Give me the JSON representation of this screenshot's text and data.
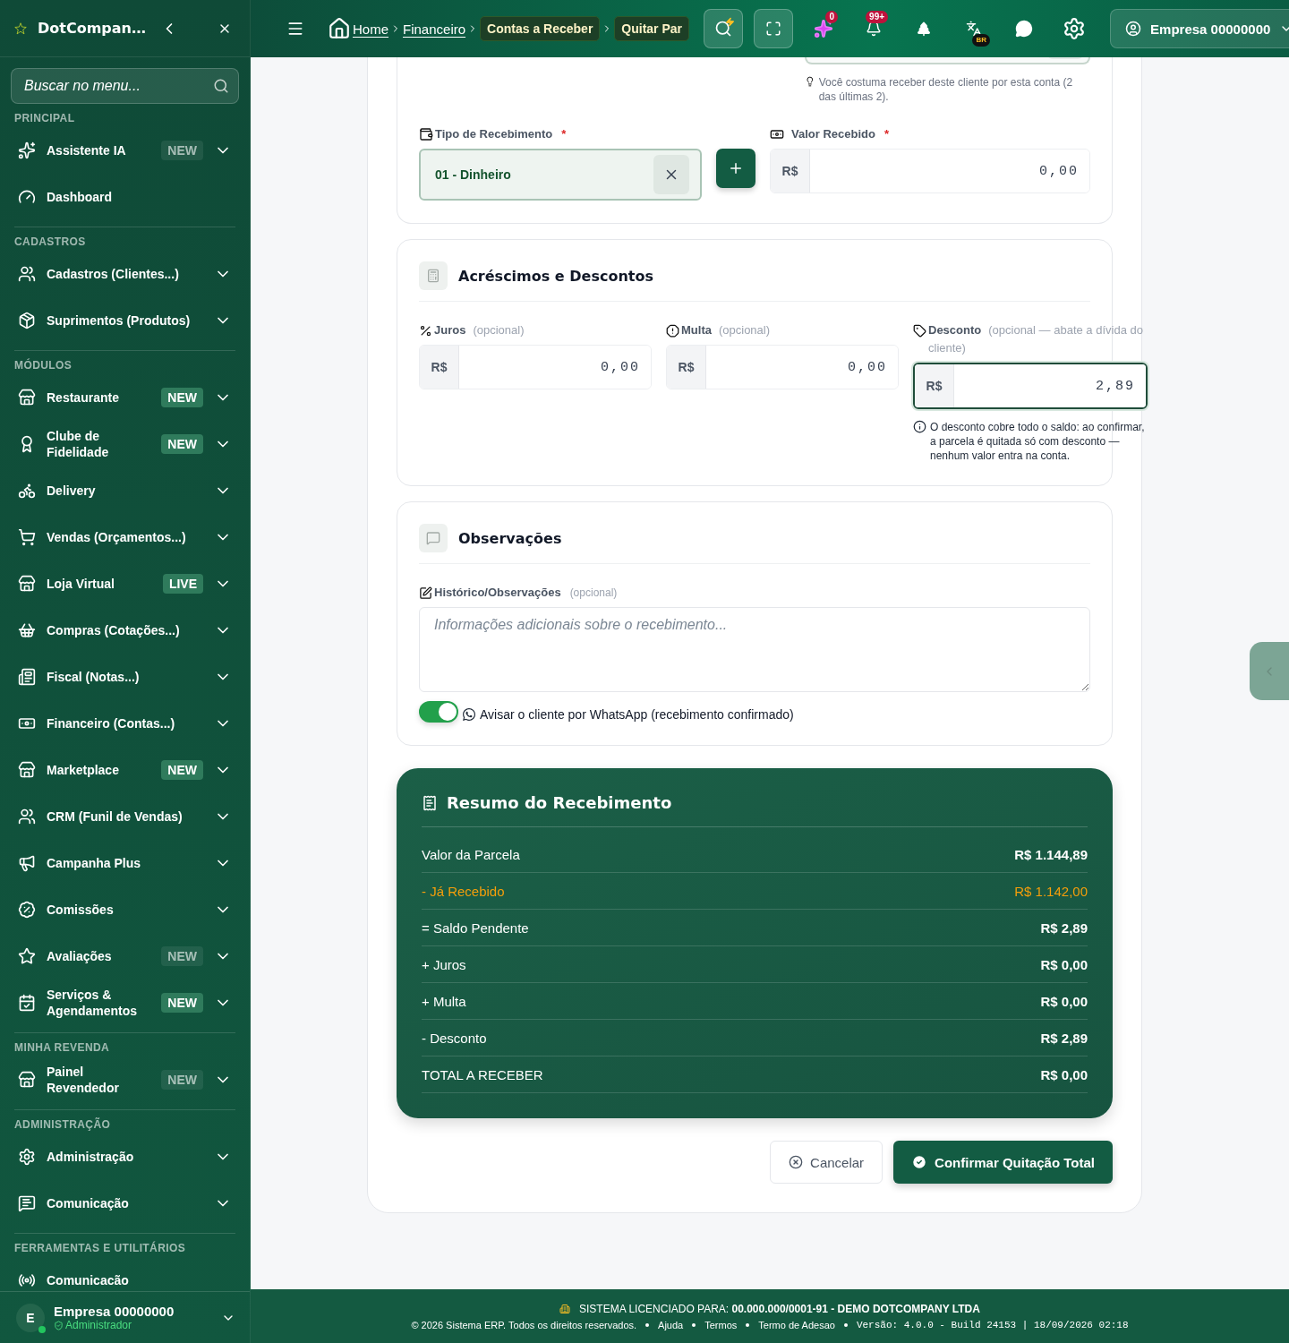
{
  "sidebar": {
    "brand": "DotCompan…",
    "search": {
      "placeholder": "Buscar no menu..."
    },
    "sections": [
      {
        "title": "PRINCIPAL",
        "items": [
          {
            "label": "Assistente IA",
            "badge": {
              "text": "NEW",
              "highlighted": false
            },
            "expandable": true
          },
          {
            "label": "Dashboard",
            "expandable": false
          }
        ]
      },
      {
        "title": "CADASTROS",
        "items": [
          {
            "label": "Cadastros (Clientes...)",
            "expandable": true
          },
          {
            "label": "Suprimentos (Produtos)",
            "expandable": true
          }
        ]
      },
      {
        "title": "MÓDULOS",
        "items": [
          {
            "label": "Restaurante",
            "badge": {
              "text": "NEW",
              "highlighted": true
            },
            "expandable": true
          },
          {
            "label": "Clube de Fidelidade",
            "badge": {
              "text": "NEW",
              "highlighted": true
            },
            "expandable": true
          },
          {
            "label": "Delivery",
            "expandable": true
          },
          {
            "label": "Vendas (Orçamentos...)",
            "expandable": true
          },
          {
            "label": "Loja Virtual",
            "badge": {
              "text": "LIVE",
              "highlighted": true
            },
            "expandable": true
          },
          {
            "label": "Compras (Cotações...)",
            "expandable": true
          },
          {
            "label": "Fiscal (Notas...)",
            "expandable": true
          },
          {
            "label": "Financeiro (Contas...)",
            "expandable": true
          },
          {
            "label": "Marketplace",
            "badge": {
              "text": "NEW",
              "highlighted": true
            },
            "expandable": true
          },
          {
            "label": "CRM (Funil de Vendas)",
            "expandable": true
          },
          {
            "label": "Campanha Plus",
            "expandable": true
          },
          {
            "label": "Comissões",
            "expandable": true
          },
          {
            "label": "Avaliações",
            "badge": {
              "text": "NEW",
              "highlighted": false
            },
            "expandable": true
          },
          {
            "label": "Serviços & Agendamentos",
            "badge": {
              "text": "NEW",
              "highlighted": true
            },
            "expandable": true
          }
        ]
      },
      {
        "title": "MINHA REVENDA",
        "items": [
          {
            "label": "Painel Revendedor",
            "badge": {
              "text": "NEW",
              "highlighted": false
            },
            "expandable": true
          }
        ]
      },
      {
        "title": "ADMINISTRAÇÃO",
        "items": [
          {
            "label": "Administração",
            "expandable": true
          },
          {
            "label": "Comunicação",
            "expandable": true
          }
        ]
      },
      {
        "title": "FERRAMENTAS E UTILITÁRIOS",
        "items": [
          {
            "label": "Comunicacão",
            "expandable": false
          }
        ]
      }
    ],
    "profile": {
      "initial": "E",
      "name": "Empresa 00000000",
      "role": "Administrador"
    }
  },
  "header": {
    "breadcrumb": [
      {
        "label": "Home",
        "kind": "link"
      },
      {
        "label": "Financeiro",
        "kind": "link"
      },
      {
        "label": "Contas a Receber",
        "kind": "chip"
      },
      {
        "label": "Quitar Par",
        "kind": "chip"
      }
    ],
    "ai_badge": "0",
    "bell_badge": "99+",
    "language_badge": "BR",
    "account": "Empresa 00000000"
  },
  "payment": {
    "hint": "Você costuma receber deste cliente por esta conta (2 das últimas 2).",
    "type_field": {
      "label": "Tipo de Recebimento",
      "required_mark": "*",
      "value": "01 - Dinheiro"
    },
    "amount_field": {
      "label": "Valor Recebido",
      "required_mark": "*",
      "prefix": "R$",
      "value": "0,00"
    }
  },
  "adjustments": {
    "title": "Acréscimos e Descontos",
    "fields": [
      {
        "label": "Juros",
        "hint": "(opcional)",
        "prefix": "R$",
        "value": "0,00",
        "focused": false
      },
      {
        "label": "Multa",
        "hint": "(opcional)",
        "prefix": "R$",
        "value": "0,00",
        "focused": false
      },
      {
        "label": "Desconto",
        "hint": "(opcional — abate a dívida do cliente)",
        "prefix": "R$",
        "value": "2,89",
        "focused": true
      }
    ],
    "note": "O desconto cobre todo o saldo: ao confirmar, a parcela é quitada só com desconto — nenhum valor entra na conta."
  },
  "observations": {
    "title": "Observações",
    "label": "Histórico/Observações",
    "hint": "(opcional)",
    "placeholder": "Informações adicionais sobre o recebimento...",
    "notify": {
      "on": true,
      "label": "Avisar o cliente por WhatsApp (recebimento confirmado)"
    }
  },
  "summary": {
    "title": "Resumo do Recebimento",
    "rows": [
      {
        "label": "Valor da Parcela",
        "value": "R$ 1.144,89",
        "kind": "normal"
      },
      {
        "label": "- Já Recebido",
        "value": "R$ 1.142,00",
        "kind": "received"
      },
      {
        "label": "= Saldo Pendente",
        "value": "R$ 2,89",
        "kind": "normal"
      },
      {
        "label": "+ Juros",
        "value": "R$ 0,00",
        "kind": "normal"
      },
      {
        "label": "+ Multa",
        "value": "R$ 0,00",
        "kind": "normal"
      },
      {
        "label": "- Desconto",
        "value": "R$ 2,89",
        "kind": "normal"
      },
      {
        "label": "TOTAL A RECEBER",
        "value": "R$ 0,00",
        "kind": "normal"
      }
    ]
  },
  "actions": [
    {
      "label": "Cancelar",
      "kind": "secondary"
    },
    {
      "label": "Confirmar Quitação Total",
      "kind": "primary"
    }
  ],
  "footer": {
    "license": "SISTEMA LICENCIADO PARA: **00.000.000/0001-91 - DEMO DOTCOMPANY LTDA**",
    "copyright": "© 2026 Sistema ERP. Todos os direitos reservados.",
    "links": [
      "Ajuda",
      "Termos",
      "Termo de Adesao"
    ],
    "version": "Versão: 4.0.0 - Build 24153 | 18/09/2026 02:18"
  }
}
